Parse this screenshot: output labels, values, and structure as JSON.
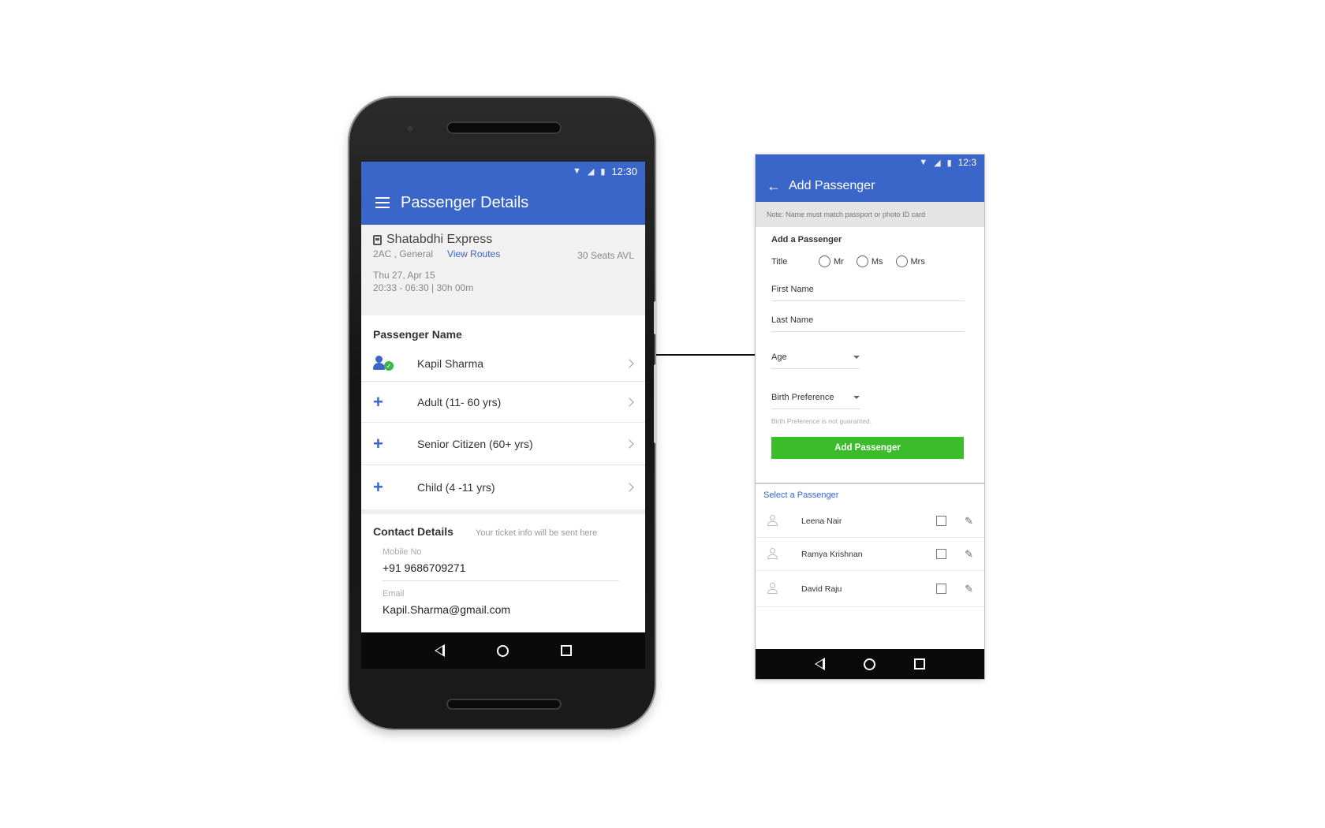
{
  "phone": {
    "status": {
      "wifi_icon": "wifi-icon",
      "signal_icon": "signal-icon",
      "battery_icon": "battery-icon",
      "time": "12:30"
    },
    "appbar": {
      "menu_icon": "menu-icon",
      "title": "Passenger Details"
    },
    "train": {
      "icon": "train-icon",
      "name": "Shatabdhi Express",
      "class": "2AC , General",
      "view_routes": "View Routes",
      "seats": "30 Seats AVL",
      "date": "Thu 27, Apr 15",
      "timing": "20:33 - 06:30 | 30h 00m"
    },
    "passenger_section": {
      "title": "Passenger Name",
      "selected": {
        "name": "Kapil Sharma",
        "icon": "user-check-icon"
      },
      "add_rows": [
        {
          "icon": "plus-icon",
          "label": "Adult (11- 60 yrs)"
        },
        {
          "icon": "plus-icon",
          "label": "Senior Citizen (60+ yrs)"
        },
        {
          "icon": "plus-icon",
          "label": "Child (4 -11 yrs)"
        }
      ]
    },
    "contact": {
      "title": "Contact Details",
      "note": "Your ticket info will be sent here",
      "mobile_label": "Mobile No",
      "mobile_value": "+91 9686709271",
      "email_label": "Email",
      "email_value": "Kapil.Sharma@gmail.com"
    },
    "navbar": {
      "back_icon": "back-triangle-icon",
      "home_icon": "home-circle-icon",
      "recent_icon": "recents-square-icon"
    }
  },
  "add_passenger": {
    "status": {
      "time": "12:3"
    },
    "appbar": {
      "back_icon": "arrow-left-icon",
      "title": "Add Passenger"
    },
    "note": "Note: Name must match passport or photo ID card",
    "form": {
      "title": "Add a Passenger",
      "title_label": "Title",
      "title_options": [
        "Mr",
        "Ms",
        "Mrs"
      ],
      "first_name_placeholder": "First Name",
      "last_name_placeholder": "Last Name",
      "age_label": "Age",
      "birth_label": "Birth Preference",
      "birth_hint": "Birth Preference is not guaranted.",
      "button": "Add Passenger"
    },
    "select_section": {
      "title": "Select a Passenger",
      "passengers": [
        {
          "name": "Leena Nair"
        },
        {
          "name": "Ramya Krishnan"
        },
        {
          "name": "David Raju"
        }
      ]
    },
    "colors": {
      "primary": "#3a65c9",
      "button_green": "#3bbd2b"
    }
  }
}
